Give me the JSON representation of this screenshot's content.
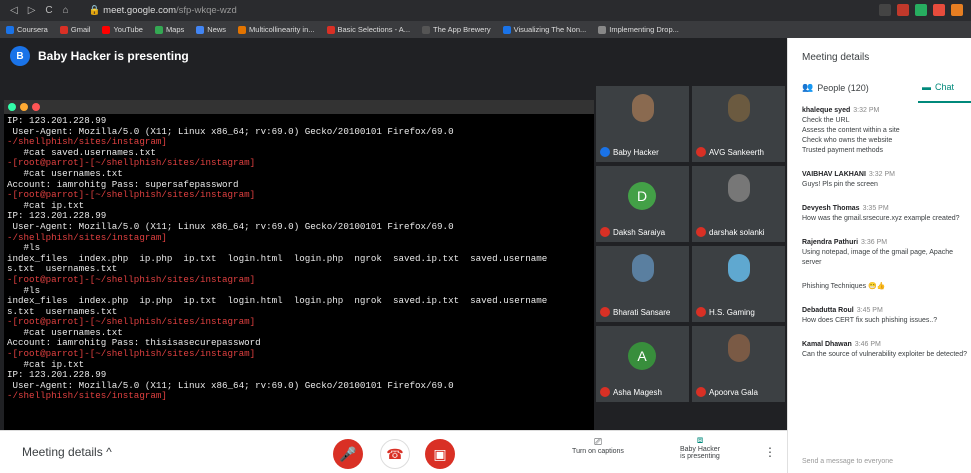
{
  "browser": {
    "url_host": "meet.google.com",
    "url_path": "/sfp-wkqe-wzd",
    "bookmarks": [
      "Coursera",
      "Gmail",
      "YouTube",
      "Maps",
      "News",
      "Multicollinearity in...",
      "Basic Selections - A...",
      "The App Brewery",
      "Visualizing The Non...",
      "Implementing Drop..."
    ]
  },
  "presenter": {
    "initial": "B",
    "label": "Baby Hacker is presenting"
  },
  "terminal": {
    "lines": [
      {
        "t": "IP: 123.201.228.99",
        "c": "wht"
      },
      {
        "t": " User-Agent: Mozilla/5.0 (X11; Linux x86_64; rv:69.0) Gecko/20100101 Firefox/69.0",
        "c": "wht"
      },
      {
        "t": "-/shellphish/sites/instagram]",
        "c": "red"
      },
      {
        "t": "   #cat saved.usernames.txt",
        "c": "wht"
      },
      {
        "t": "-[root@parrot]-[~/shellphish/sites/instagram]",
        "c": "red"
      },
      {
        "t": "   #cat usernames.txt",
        "c": "wht"
      },
      {
        "t": "Account: iamrohitg Pass: supersafepassword",
        "c": "wht"
      },
      {
        "t": "-[root@parrot]-[~/shellphish/sites/instagram]",
        "c": "red"
      },
      {
        "t": "   #cat ip.txt",
        "c": "wht"
      },
      {
        "t": "IP: 123.201.228.99",
        "c": "wht"
      },
      {
        "t": " User-Agent: Mozilla/5.0 (X11; Linux x86_64; rv:69.0) Gecko/20100101 Firefox/69.0",
        "c": "wht"
      },
      {
        "t": "-/shellphish/sites/instagram]",
        "c": "red"
      },
      {
        "t": "   #ls",
        "c": "wht"
      },
      {
        "t": "index_files  index.php  ip.php  ip.txt  login.html  login.php  ngrok  saved.ip.txt  saved.username",
        "c": "wht"
      },
      {
        "t": "s.txt  usernames.txt",
        "c": "wht"
      },
      {
        "t": "-[root@parrot]-[~/shellphish/sites/instagram]",
        "c": "red"
      },
      {
        "t": "   #ls",
        "c": "wht"
      },
      {
        "t": "index_files  index.php  ip.php  ip.txt  login.html  login.php  ngrok  saved.ip.txt  saved.username",
        "c": "wht"
      },
      {
        "t": "s.txt  usernames.txt",
        "c": "wht"
      },
      {
        "t": "-[root@parrot]-[~/shellphish/sites/instagram]",
        "c": "red"
      },
      {
        "t": "   #cat usernames.txt",
        "c": "wht"
      },
      {
        "t": "Account: iamrohitg Pass: thisisasecurepassword",
        "c": "wht"
      },
      {
        "t": "-[root@parrot]-[~/shellphish/sites/instagram]",
        "c": "red"
      },
      {
        "t": "   #cat ip.txt",
        "c": "wht"
      },
      {
        "t": "IP: 123.201.228.99",
        "c": "wht"
      },
      {
        "t": " User-Agent: Mozilla/5.0 (X11; Linux x86_64; rv:69.0) Gecko/20100101 Firefox/69.0",
        "c": "wht"
      },
      {
        "t": "-/shellphish/sites/instagram]",
        "c": "red"
      }
    ]
  },
  "participants": [
    {
      "name": "Baby Hacker",
      "muted": false,
      "avatar": "photo",
      "color": "#8a6a50"
    },
    {
      "name": "AVG Sankeerth",
      "muted": true,
      "avatar": "photo",
      "color": "#6b5a40"
    },
    {
      "name": "Daksh Saraiya",
      "muted": true,
      "avatar": "D",
      "color": "#43a047"
    },
    {
      "name": "darshak solanki",
      "muted": true,
      "avatar": "photo",
      "color": "#777777"
    },
    {
      "name": "Bharati Sansare",
      "muted": true,
      "avatar": "photo",
      "color": "#5a7fa0"
    },
    {
      "name": "H.S. Gaming",
      "muted": true,
      "avatar": "photo",
      "color": "#5fa8d0"
    },
    {
      "name": "Asha Magesh",
      "muted": true,
      "avatar": "A",
      "color": "#388e3c"
    },
    {
      "name": "Apoorva Gala",
      "muted": true,
      "avatar": "photo",
      "color": "#7a5a45"
    }
  ],
  "bottom": {
    "meeting_details": "Meeting details",
    "captions": "Turn on captions",
    "presenting_line1": "Baby Hacker",
    "presenting_line2": "is presenting"
  },
  "panel": {
    "title": "Meeting details",
    "people": "People (120)",
    "chat": "Chat",
    "input_placeholder": "Send a message to everyone",
    "messages": [
      {
        "from": "khaleque syed",
        "time": "3:32 PM",
        "lines": [
          "Check the URL",
          "Assess the content within a site",
          "Check who owns the website",
          "Trusted payment methods"
        ]
      },
      {
        "from": "VAIBHAV LAKHANI",
        "time": "3:32 PM",
        "lines": [
          "Guys! Pls pin the screen"
        ]
      },
      {
        "from": "Devyesh Thomas",
        "time": "3:35 PM",
        "lines": [
          "How was the gmail.srsecure.xyz example created?"
        ]
      },
      {
        "from": "Rajendra Pathuri",
        "time": "3:36 PM",
        "lines": [
          "Using notepad, image of the gmail page, Apache server"
        ]
      },
      {
        "from": "",
        "time": "",
        "lines": [
          "Phishing Techniques 😁👍"
        ]
      },
      {
        "from": "Debadutta Roul",
        "time": "3:45 PM",
        "lines": [
          "How does CERT fix such phishing issues..?"
        ]
      },
      {
        "from": "Kamal Dhawan",
        "time": "3:46 PM",
        "lines": [
          "Can the source of vulnerability exploiter be detected?"
        ]
      }
    ]
  },
  "colors": {
    "accent": "#00897b",
    "danger": "#d93025",
    "presenter": "#1a73e8"
  }
}
